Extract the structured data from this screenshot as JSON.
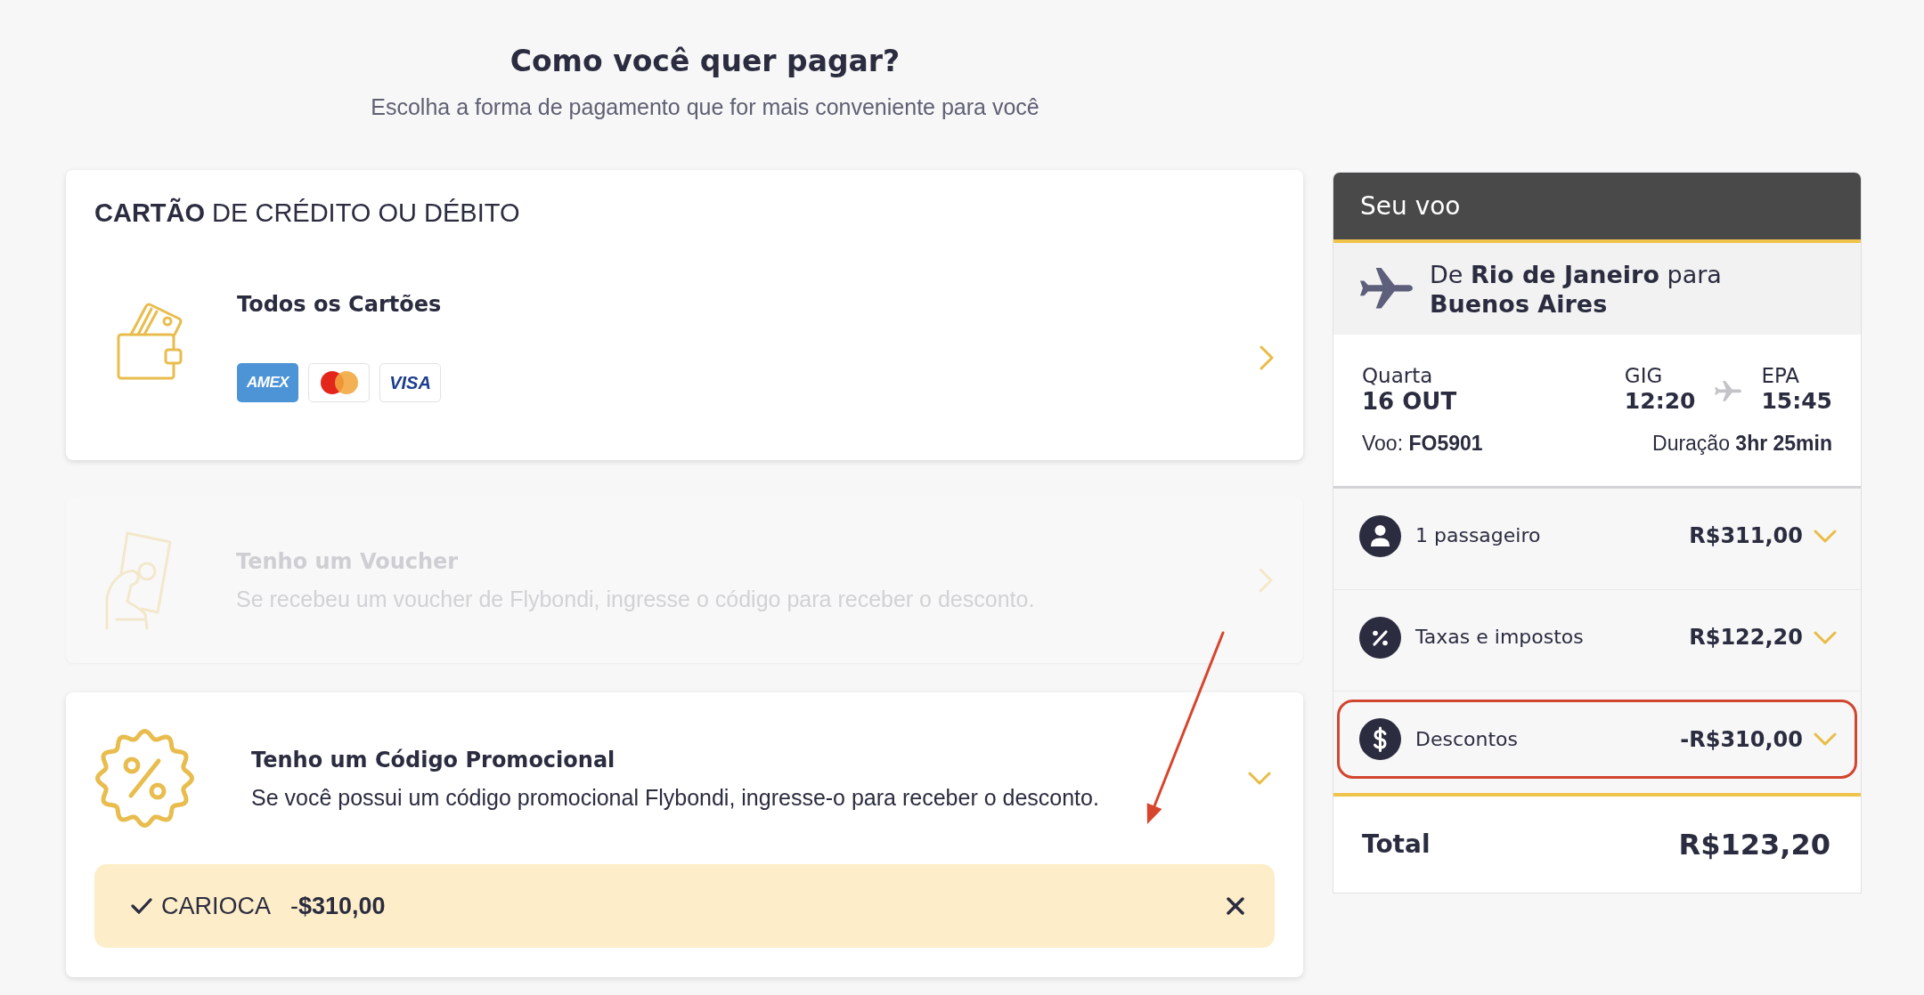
{
  "header": {
    "title": "Como você quer pagar?",
    "subtitle": "Escolha a forma de pagamento que for mais conveniente para você"
  },
  "payment_options": [
    {
      "kind": "cards",
      "section_title": "**CARTÃO** DE CRÉDITO OU DÉBITO",
      "title": "Todos os Cartões",
      "card_brands": [
        {
          "kind": "amex",
          "label": "AMEX"
        },
        {
          "kind": "mastercard"
        },
        {
          "kind": "visa",
          "label": "VISA"
        }
      ],
      "disabled": false,
      "expanded": false
    },
    {
      "kind": "voucher",
      "title": "Tenho um Voucher",
      "description": "Se recebeu um voucher de Flybondi, ingresse o código para receber o desconto.",
      "disabled": true,
      "expanded": false
    },
    {
      "kind": "promo_code",
      "title": "Tenho um Código Promocional",
      "description": "Se você possui um código promocional Flybondi, ingresse-o para receber o desconto.",
      "disabled": false,
      "expanded": true,
      "applied_code": {
        "code": "CARIOCA",
        "amount": "-**$310,00**"
      }
    }
  ],
  "flight_summary": {
    "title": "Seu voo",
    "route": "De **Rio de Janeiro** para **Buenos Aires**",
    "day": "Quarta",
    "date": "16 OUT",
    "departure": {
      "airport": "GIG",
      "time": "12:20"
    },
    "arrival": {
      "airport": "EPA",
      "time": "15:45"
    },
    "flight_number": "Voo: **FO5901**",
    "duration": "Duração **3hr 25min**",
    "items": [
      {
        "kind": "passengers",
        "label": "1 passageiro",
        "amount": "R$311,00",
        "expanded": false,
        "highlighted": false
      },
      {
        "kind": "taxes",
        "label": "Taxas e impostos",
        "amount": "R$122,20",
        "expanded": false,
        "highlighted": false
      },
      {
        "kind": "discounts",
        "label": "Descontos",
        "amount": "-R$310,00",
        "expanded": false,
        "highlighted": true
      }
    ],
    "total": {
      "label": "Total",
      "amount": "R$123,20"
    }
  }
}
